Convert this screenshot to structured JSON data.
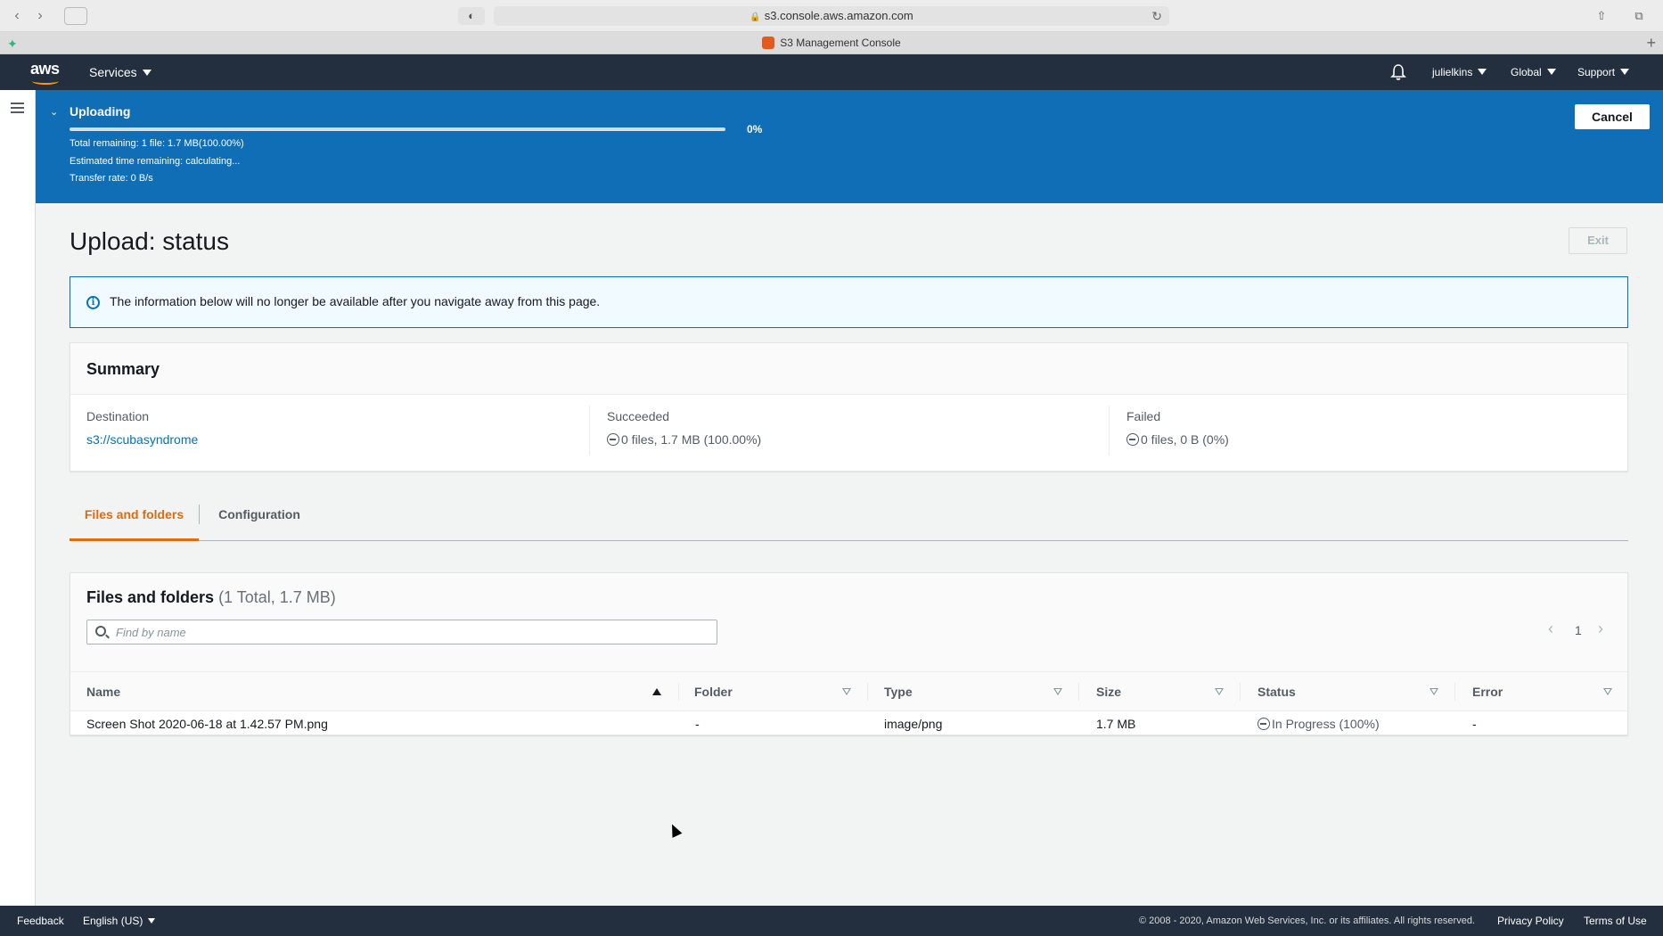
{
  "browser": {
    "url": "s3.console.aws.amazon.com",
    "tab_title": "S3 Management Console"
  },
  "nav": {
    "services_label": "Services",
    "user_label": "julielkins",
    "region_label": "Global",
    "support_label": "Support",
    "logo_text": "aws"
  },
  "upload": {
    "title": "Uploading",
    "progress_percent": 0,
    "progress_label": "0%",
    "total_remaining": "Total remaining: 1 file: 1.7 MB(100.00%)",
    "time_remaining": "Estimated time remaining: calculating...",
    "transfer_rate": "Transfer rate: 0 B/s",
    "cancel_label": "Cancel"
  },
  "page": {
    "title": "Upload: status",
    "exit_label": "Exit",
    "info_message": "The information below will no longer be available after you navigate away from this page."
  },
  "summary": {
    "heading": "Summary",
    "destination_label": "Destination",
    "destination_value": "s3://scubasyndrome",
    "succeeded_label": "Succeeded",
    "succeeded_value": "0 files, 1.7 MB (100.00%)",
    "failed_label": "Failed",
    "failed_value": "0 files, 0 B (0%)"
  },
  "tabs": [
    {
      "label": "Files and folders",
      "active": true
    },
    {
      "label": "Configuration",
      "active": false
    }
  ],
  "files": {
    "title": "Files and folders",
    "count": "(1 Total, 1.7 MB)",
    "search_placeholder": "Find by name",
    "page_number": "1",
    "columns": [
      "Name",
      "Folder",
      "Type",
      "Size",
      "Status",
      "Error"
    ],
    "rows": [
      {
        "name": "Screen Shot 2020-06-18 at 1.42.57 PM.png",
        "folder": "-",
        "type": "image/png",
        "size": "1.7 MB",
        "status": "In Progress (100%)",
        "error": "-"
      }
    ]
  },
  "footer": {
    "feedback": "Feedback",
    "language": "English (US)",
    "copyright": "© 2008 - 2020, Amazon Web Services, Inc. or its affiliates. All rights reserved.",
    "privacy": "Privacy Policy",
    "terms": "Terms of Use"
  },
  "colors": {
    "banner_blue": "#0f6eb5",
    "nav_dark": "#232f3e",
    "accent_orange": "#dd6b10",
    "link_blue": "#0073bb"
  }
}
